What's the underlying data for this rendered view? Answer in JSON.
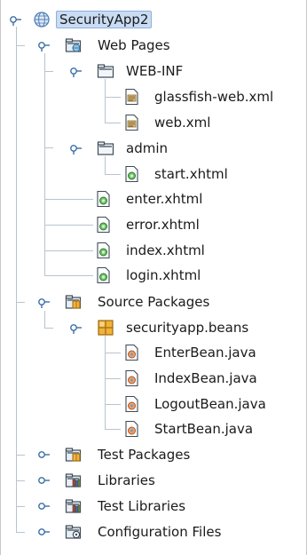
{
  "tree": {
    "root": {
      "label": "SecurityApp2",
      "icon": "globe-icon",
      "state": "expanded",
      "selected": true
    },
    "web_pages": {
      "label": "Web Pages",
      "icon": "web-pages-folder-icon",
      "web_inf": {
        "label": "WEB-INF",
        "files": [
          "glassfish-web.xml",
          "web.xml"
        ]
      },
      "admin": {
        "label": "admin",
        "files": [
          "start.xhtml"
        ]
      },
      "files": [
        "enter.xhtml",
        "error.xhtml",
        "index.xhtml",
        "login.xhtml"
      ]
    },
    "source_packages": {
      "label": "Source Packages",
      "package": {
        "label": "securityapp.beans",
        "files": [
          "EnterBean.java",
          "IndexBean.java",
          "LogoutBean.java",
          "StartBean.java"
        ]
      }
    },
    "test_packages": {
      "label": "Test Packages",
      "state": "collapsed"
    },
    "libraries": {
      "label": "Libraries",
      "state": "collapsed"
    },
    "test_libraries": {
      "label": "Test Libraries",
      "state": "collapsed"
    },
    "config_files": {
      "label": "Configuration Files",
      "state": "collapsed"
    }
  },
  "colors": {
    "selection_bg": "#c9dcf4",
    "selection_border": "#8fb0d8",
    "tree_line": "#b8c4cf",
    "folder_fill": "#e8eef4",
    "package_fill": "#f2b23a"
  }
}
